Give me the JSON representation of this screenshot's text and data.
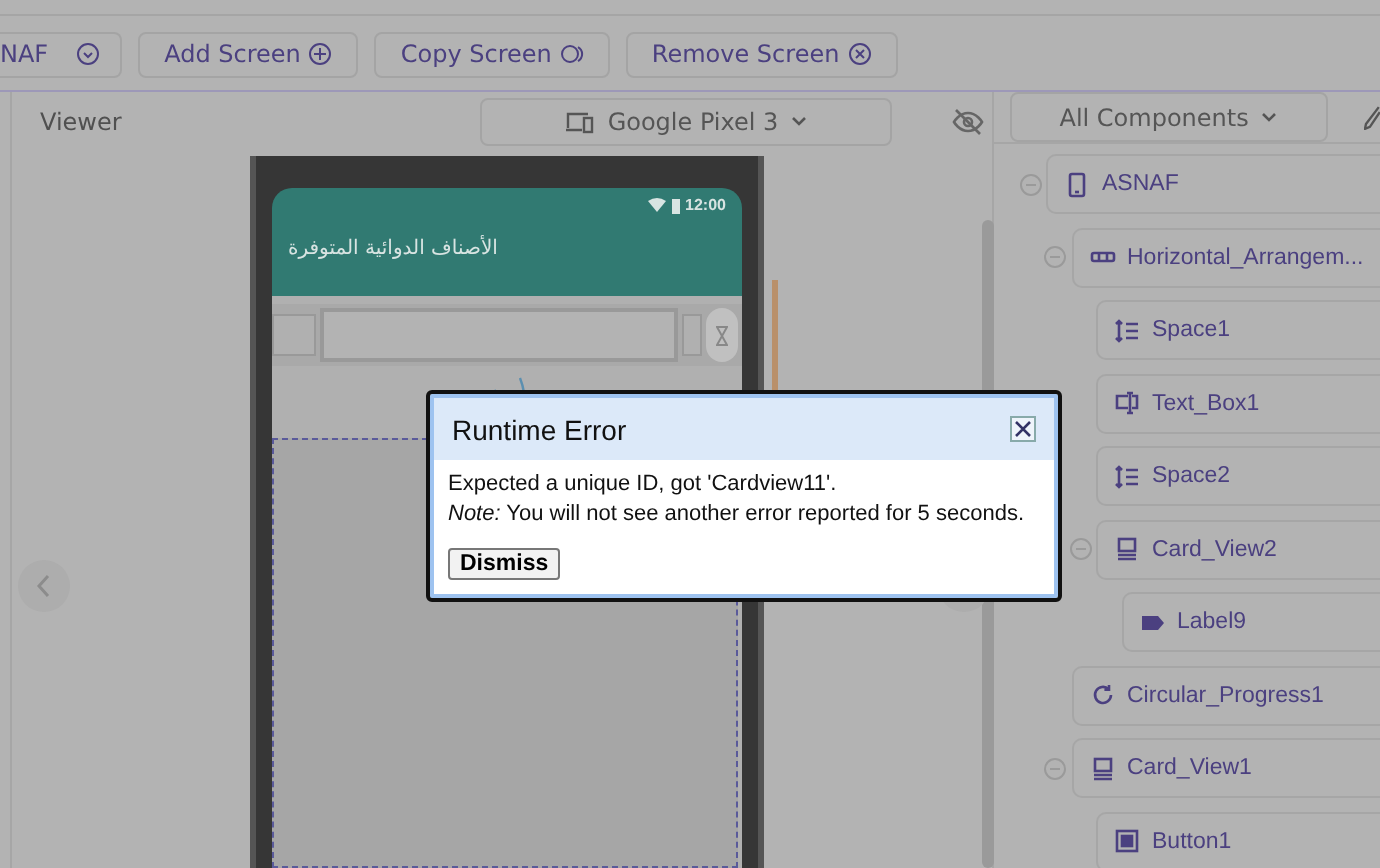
{
  "toolbar": {
    "screen_picker": {
      "label": "NAF"
    },
    "buttons": [
      {
        "label": "Add Screen",
        "kind": "add"
      },
      {
        "label": "Copy Screen",
        "kind": "copy"
      },
      {
        "label": "Remove Screen",
        "kind": "remove"
      }
    ]
  },
  "viewer": {
    "title": "Viewer",
    "device": "Google Pixel 3",
    "phone": {
      "time": "12:00",
      "app_title": "الأصناف الدوائية المتوفرة"
    }
  },
  "components": {
    "filter": "All Components",
    "tree": [
      {
        "name": "ASNAF",
        "kind": "screen",
        "expanded": true,
        "children": [
          {
            "name": "Horizontal_Arrangem...",
            "kind": "arrangement",
            "expanded": true,
            "children": [
              {
                "name": "Space1",
                "kind": "space"
              },
              {
                "name": "Text_Box1",
                "kind": "textbox"
              },
              {
                "name": "Space2",
                "kind": "space"
              },
              {
                "name": "Card_View2",
                "kind": "card",
                "expanded": true,
                "children": [
                  {
                    "name": "Label9",
                    "kind": "label"
                  }
                ]
              }
            ]
          },
          {
            "name": "Circular_Progress1",
            "kind": "progress"
          },
          {
            "name": "Card_View1",
            "kind": "card",
            "expanded": true,
            "children": [
              {
                "name": "Button1",
                "kind": "button"
              }
            ]
          }
        ]
      }
    ]
  },
  "dialog": {
    "title": "Runtime Error",
    "message": "Expected a unique ID, got 'Cardview11'.",
    "note": "*Note:* You will not see another error reported for 5 seconds.",
    "button": "Dismiss"
  }
}
